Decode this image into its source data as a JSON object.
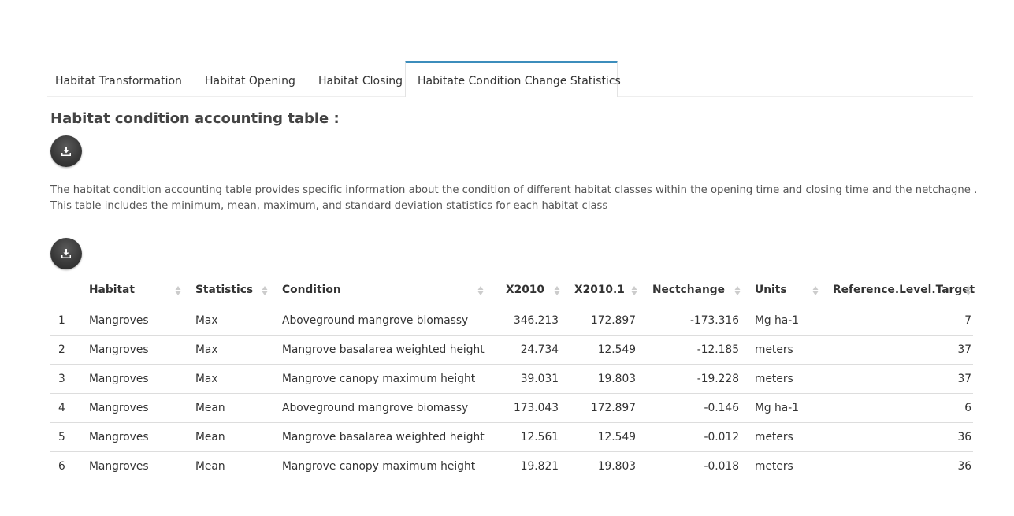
{
  "tabs": [
    {
      "label": "Habitat Transformation",
      "active": false
    },
    {
      "label": "Habitat Opening",
      "active": false
    },
    {
      "label": "Habitat Closing",
      "active": false
    },
    {
      "label": "Habitate Condition Change Statistics",
      "active": true
    }
  ],
  "section": {
    "title": "Habitat condition accounting table :",
    "description_line1": "The habitat condition accounting table provides specific information about the condition of different habitat classes within the opening time and closing time and the netchagne .",
    "description_line2": "This table includes the minimum, mean, maximum, and standard deviation statistics for each habitat class"
  },
  "icons": {
    "download": "download-icon",
    "sort": "sort-arrows-icon"
  },
  "colors": {
    "active_tab_accent": "#3c8dbc",
    "button_dark": "#3a3a3a"
  },
  "table": {
    "columns": [
      "",
      "Habitat",
      "Statistics",
      "Condition",
      "X2010",
      "X2010.1",
      "Nectchange",
      "Units",
      "Reference.Level.Target"
    ],
    "rows": [
      [
        "1",
        "Mangroves",
        "Max",
        "Aboveground mangrove biomassy",
        "346.213",
        "172.897",
        "-173.316",
        "Mg ha-1",
        "7"
      ],
      [
        "2",
        "Mangroves",
        "Max",
        "Mangrove basalarea weighted height",
        "24.734",
        "12.549",
        "-12.185",
        "meters",
        "37"
      ],
      [
        "3",
        "Mangroves",
        "Max",
        "Mangrove canopy maximum height",
        "39.031",
        "19.803",
        "-19.228",
        "meters",
        "37"
      ],
      [
        "4",
        "Mangroves",
        "Mean",
        "Aboveground mangrove biomassy",
        "173.043",
        "172.897",
        "-0.146",
        "Mg ha-1",
        "6"
      ],
      [
        "5",
        "Mangroves",
        "Mean",
        "Mangrove basalarea weighted height",
        "12.561",
        "12.549",
        "-0.012",
        "meters",
        "36"
      ],
      [
        "6",
        "Mangroves",
        "Mean",
        "Mangrove canopy maximum height",
        "19.821",
        "19.803",
        "-0.018",
        "meters",
        "36"
      ]
    ]
  }
}
